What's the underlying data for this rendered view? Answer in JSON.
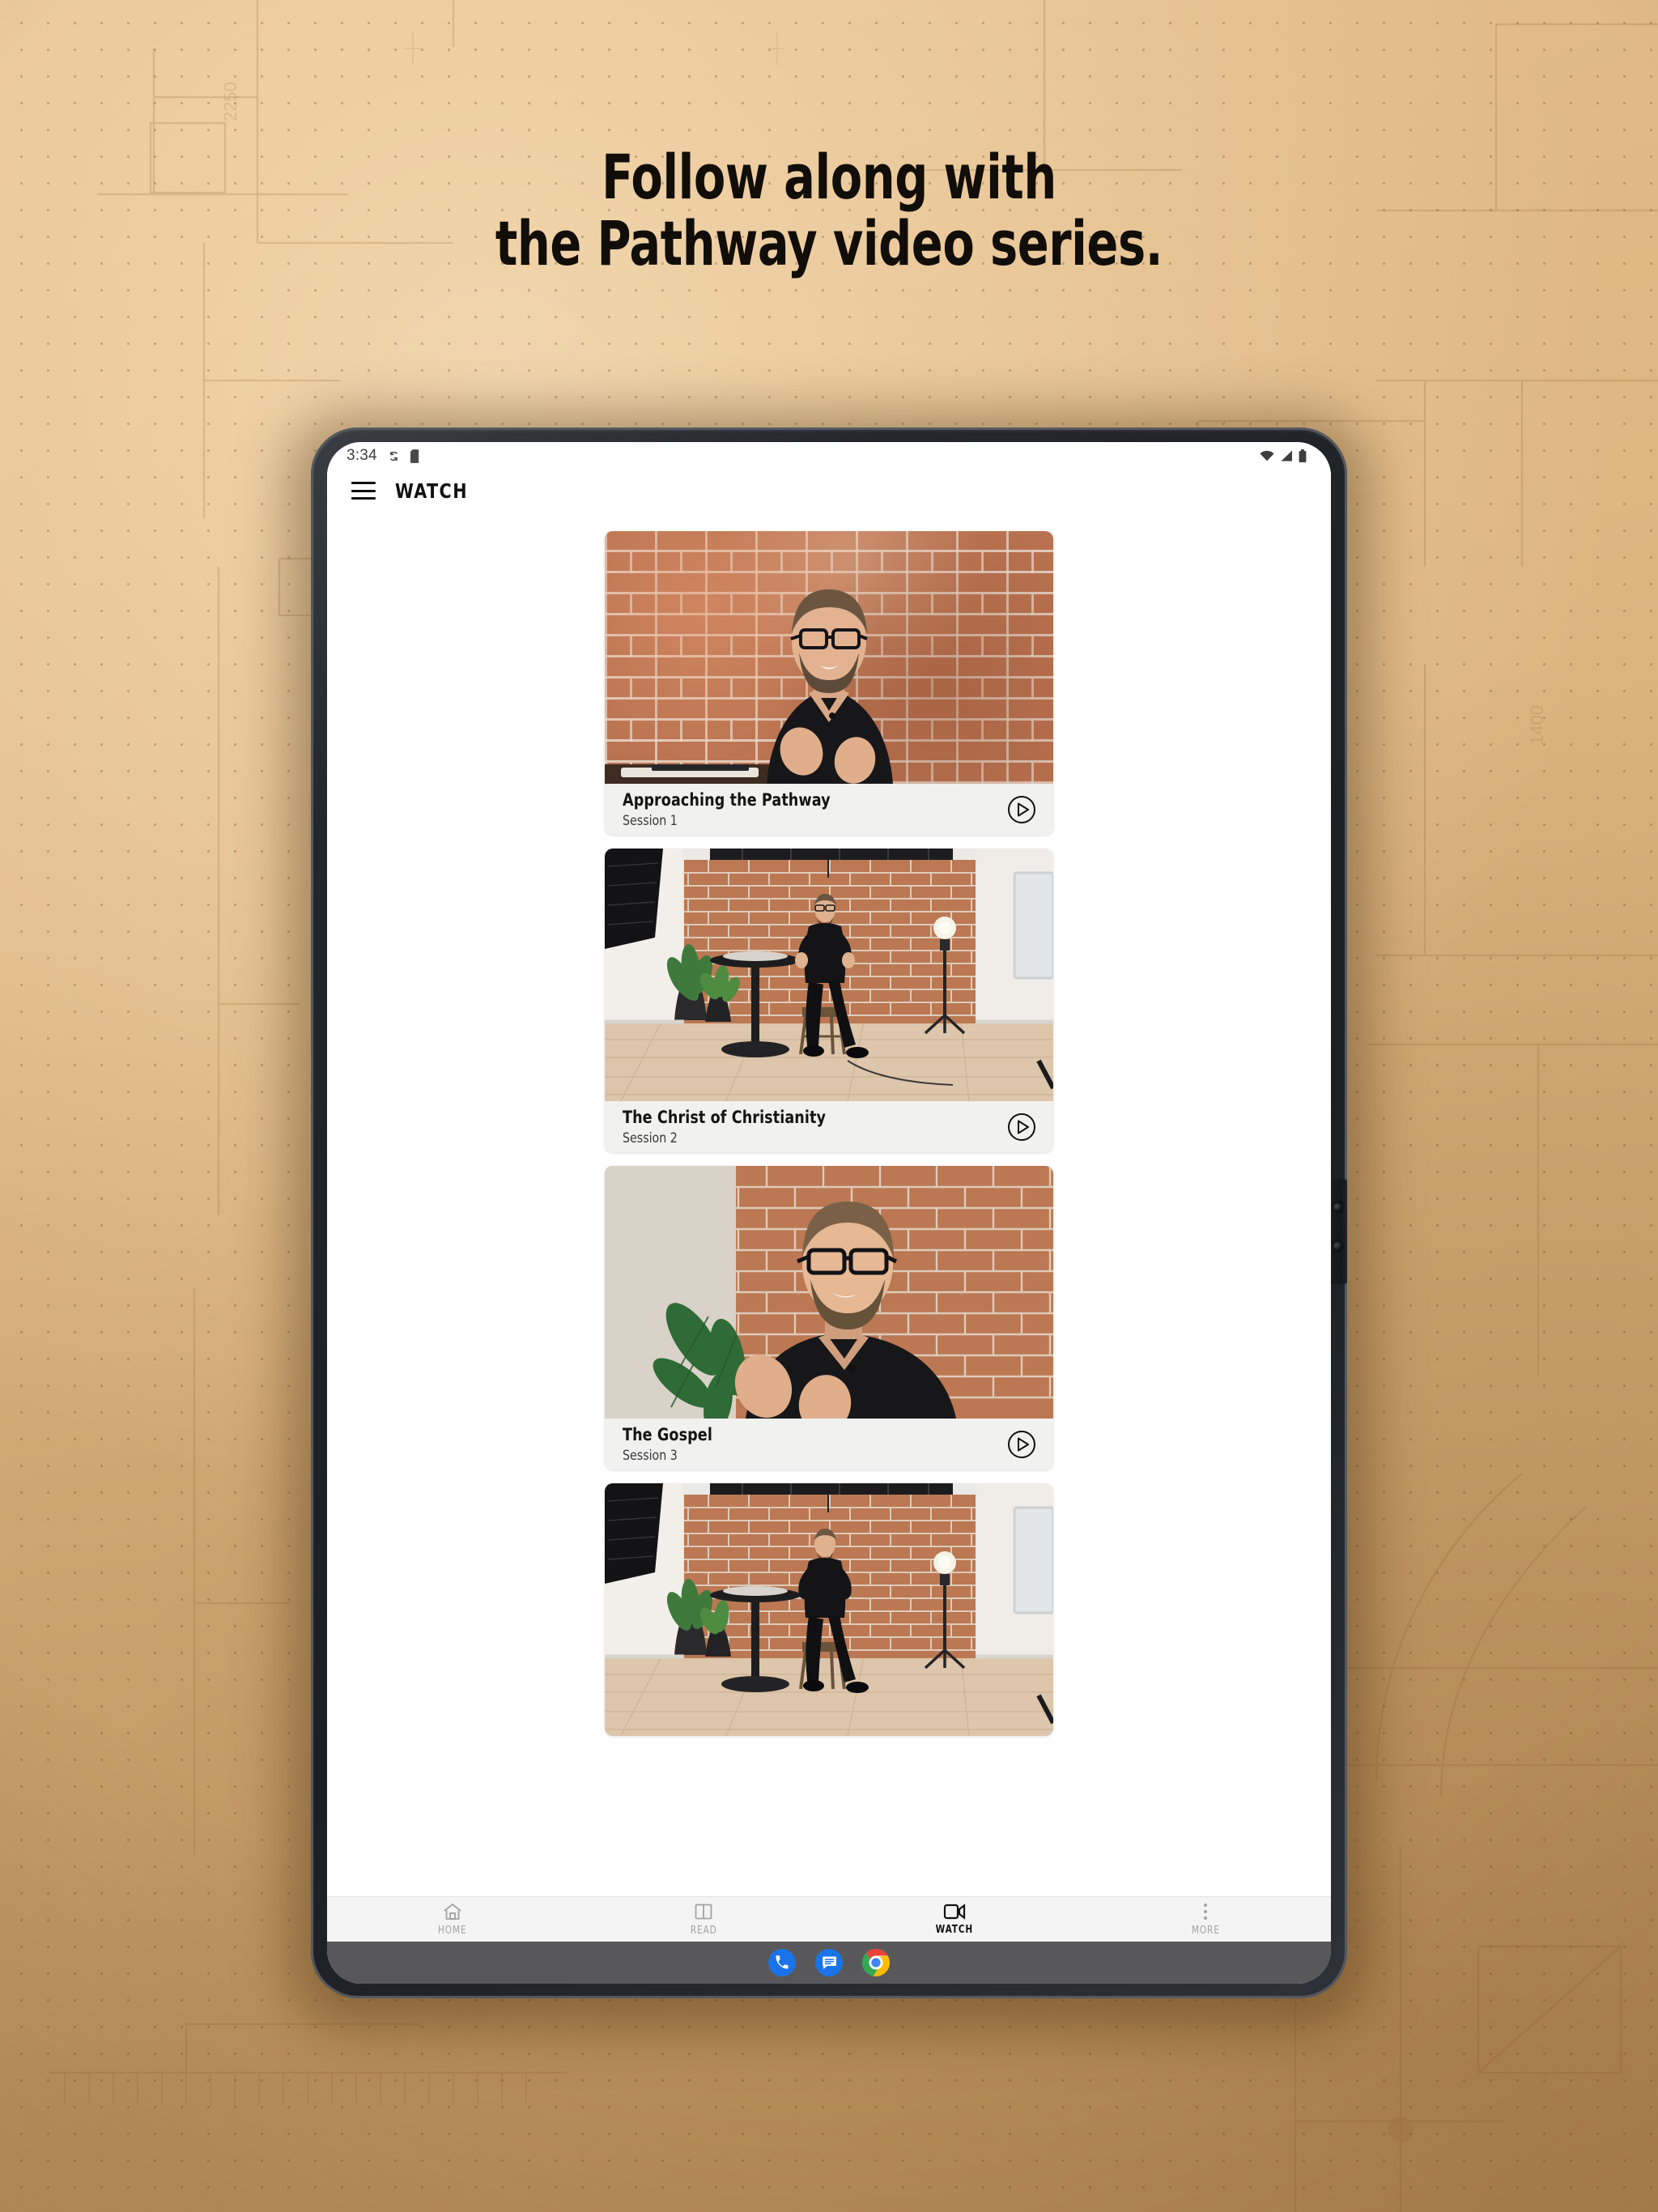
{
  "headline": {
    "line1": "Follow along with",
    "line2": "the Pathway video series."
  },
  "device": {
    "type": "android-tablet",
    "statusbar": {
      "time": "3:34",
      "left_icons": [
        "sync-icon",
        "sd-card-icon"
      ],
      "right_icons": [
        "wifi-icon",
        "cell-signal-icon",
        "battery-icon"
      ]
    },
    "taskbar": {
      "apps": [
        {
          "name": "phone-app-icon",
          "label": "Phone",
          "color": "#1a73e8"
        },
        {
          "name": "messages-app-icon",
          "label": "Messages",
          "color": "#1a73e8"
        },
        {
          "name": "chrome-app-icon",
          "label": "Chrome",
          "color": "#4285f4"
        }
      ]
    }
  },
  "app": {
    "appbar": {
      "menu_icon": "hamburger-menu-icon",
      "title": "WATCH"
    },
    "videos": [
      {
        "title": "Approaching the Pathway",
        "session": "Session 1",
        "play_icon": "play-circle-icon",
        "thumbnail": "closeup-man-black-sweater-brick-wall"
      },
      {
        "title": "The Christ of Christianity",
        "session": "Session 2",
        "play_icon": "play-circle-icon",
        "thumbnail": "wide-studio-man-on-stool-brick-wall"
      },
      {
        "title": "The Gospel",
        "session": "Session 3",
        "play_icon": "play-circle-icon",
        "thumbnail": "closeup-man-gesturing-plant-brick-wall"
      },
      {
        "title": "",
        "session": "",
        "play_icon": "play-circle-icon",
        "thumbnail": "wide-studio-man-on-stool-brick-wall"
      }
    ],
    "bottom_nav": [
      {
        "label": "HOME",
        "icon": "home-icon",
        "active": false
      },
      {
        "label": "READ",
        "icon": "book-icon",
        "active": false
      },
      {
        "label": "WATCH",
        "icon": "video-camera-icon",
        "active": true
      },
      {
        "label": "MORE",
        "icon": "more-vertical-icon",
        "active": false
      }
    ]
  },
  "colors": {
    "background_paper": "#ddb47e",
    "paper_dots": "#5e3e1a",
    "headline_text": "#110d09",
    "card_surface": "#f1f1f0",
    "active_nav": "#121212",
    "inactive_nav": "#a2a2a2",
    "bezel": "#23262c"
  }
}
